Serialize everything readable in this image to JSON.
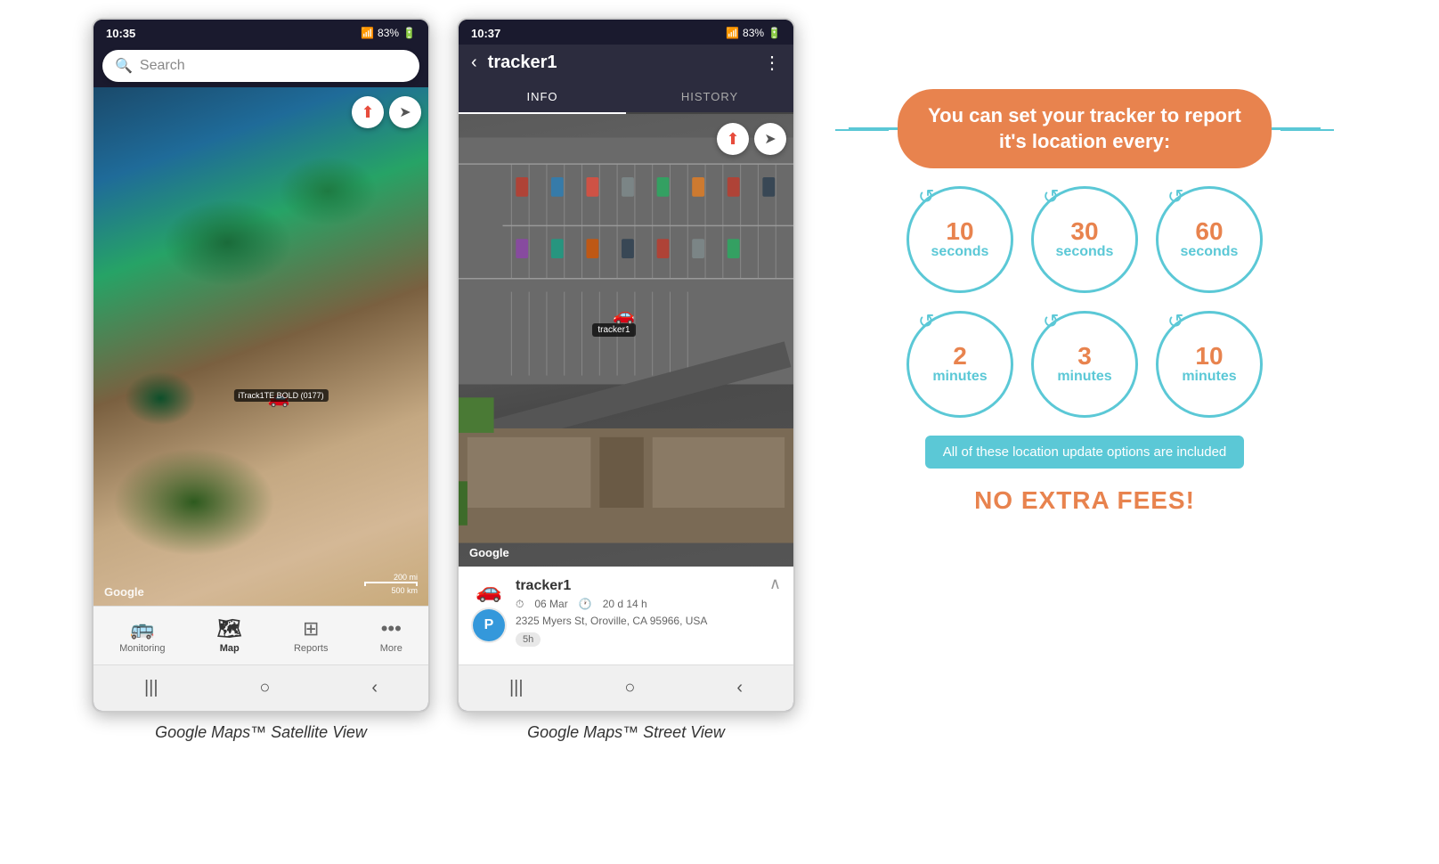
{
  "phone1": {
    "status": {
      "time": "10:35",
      "signal": "▲.ul",
      "percent": "83%"
    },
    "search": {
      "placeholder": "Search"
    },
    "map": {
      "tracker_label": "iTrack1TE BOLD (0177)",
      "google_label": "Google",
      "scale_200mi": "200 mi",
      "scale_500km": "500 km"
    },
    "nav": {
      "items": [
        {
          "label": "Monitoring",
          "icon": "🚌",
          "active": false
        },
        {
          "label": "Map",
          "icon": "🗺",
          "active": true
        },
        {
          "label": "Reports",
          "icon": "⊞",
          "active": false
        },
        {
          "label": "More",
          "icon": "•••",
          "active": false
        }
      ]
    },
    "caption": "Google Maps™ Satellite View"
  },
  "phone2": {
    "status": {
      "time": "10:37",
      "signal": "▲.ul",
      "percent": "83%"
    },
    "header": {
      "back_label": "‹",
      "title": "tracker1",
      "more_label": "⋮"
    },
    "tabs": [
      {
        "label": "INFO",
        "active": true
      },
      {
        "label": "HISTORY",
        "active": false
      }
    ],
    "map": {
      "tracker_label": "tracker1",
      "google_label": "Google"
    },
    "info": {
      "name": "tracker1",
      "date": "06 Mar",
      "duration": "20 d 14 h",
      "address": "2325 Myers St, Oroville, CA 95966, USA",
      "tag": "5h",
      "up_arrow": "∧"
    },
    "caption": "Google Maps™ Street View"
  },
  "infographic": {
    "headline": "You can set your tracker to report it's location every:",
    "circles": [
      {
        "number": "10",
        "unit": "seconds"
      },
      {
        "number": "30",
        "unit": "seconds"
      },
      {
        "number": "60",
        "unit": "seconds"
      },
      {
        "number": "2",
        "unit": "minutes"
      },
      {
        "number": "3",
        "unit": "minutes"
      },
      {
        "number": "10",
        "unit": "minutes"
      }
    ],
    "note": "All of these location update options are included",
    "no_fees": "NO EXTRA FEES!",
    "colors": {
      "orange": "#e8834e",
      "teal": "#5bc8d6"
    }
  }
}
